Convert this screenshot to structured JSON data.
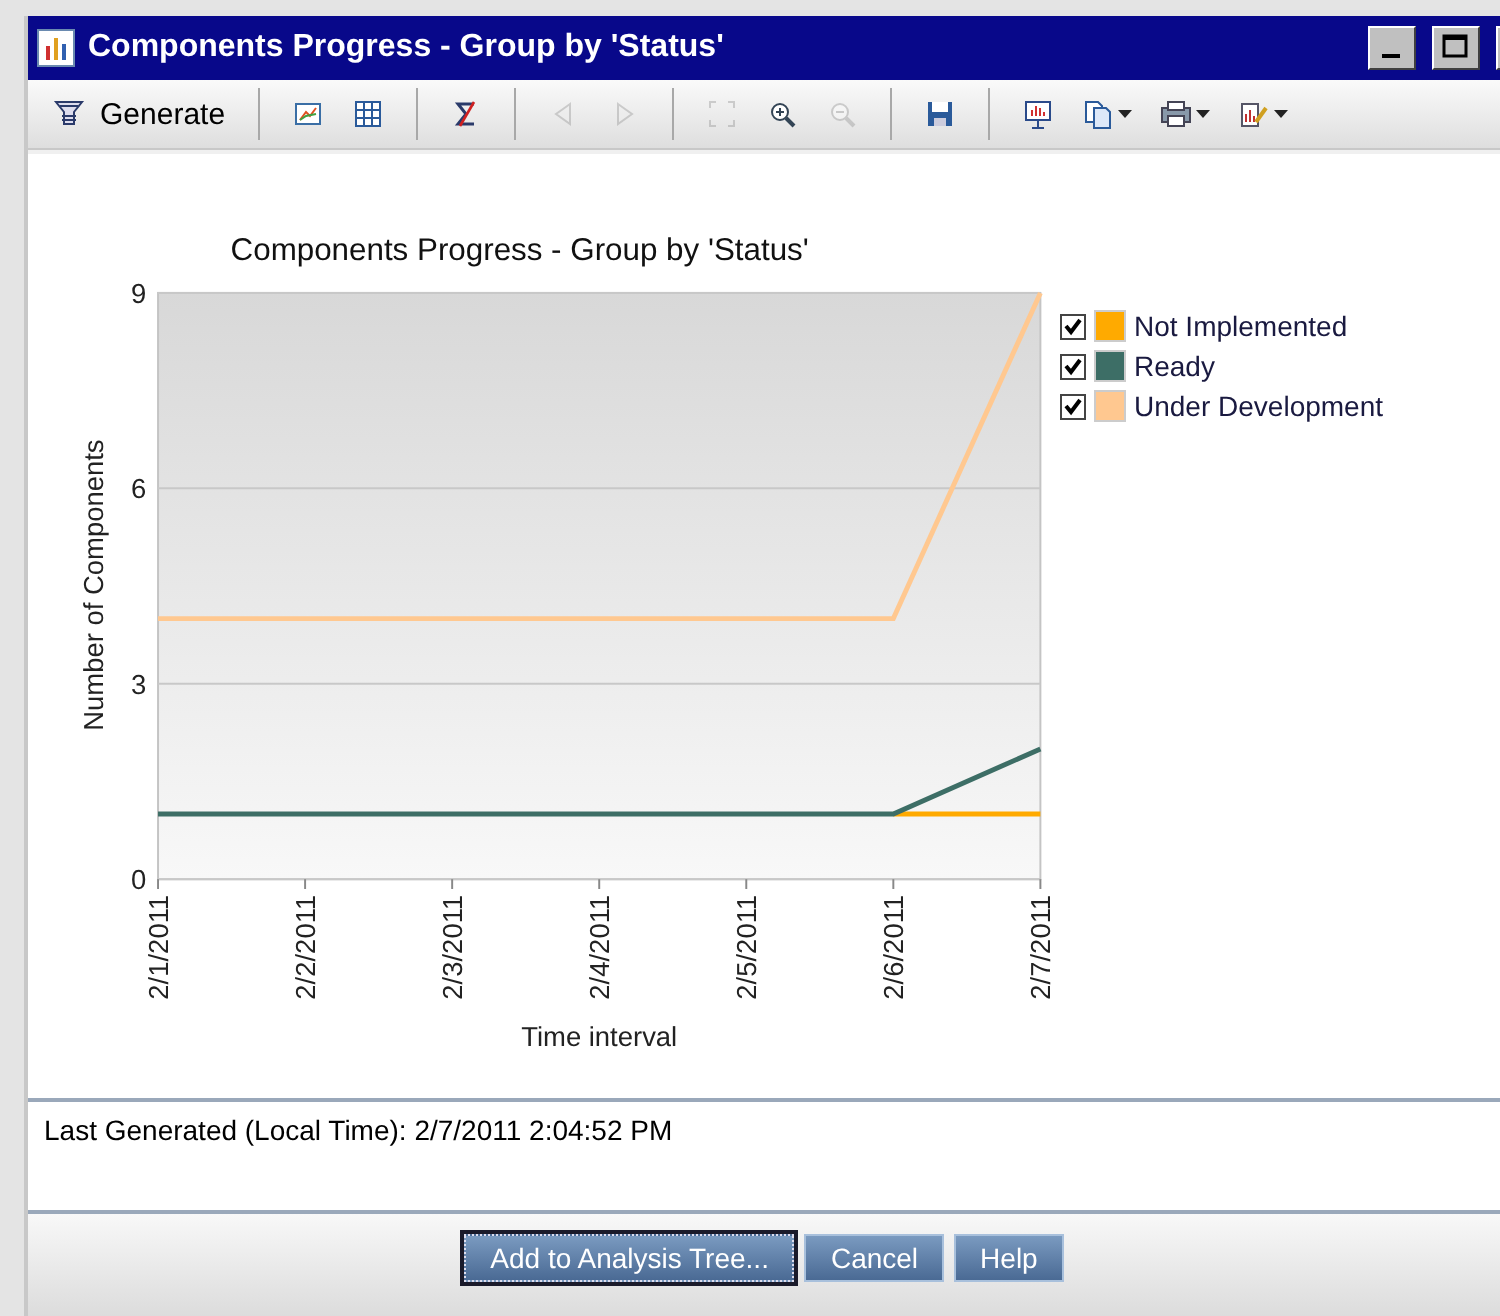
{
  "window": {
    "title": "Components Progress - Group by 'Status'"
  },
  "toolbar": {
    "generate": "Generate",
    "tools": [
      {
        "kind": "plain",
        "disabled": false
      },
      {
        "kind": "plain",
        "disabled": false
      },
      {
        "kind": "plain",
        "disabled": false
      },
      {
        "kind": "plain",
        "disabled": true
      },
      {
        "kind": "plain",
        "disabled": true
      },
      {
        "kind": "plain",
        "disabled": true
      },
      {
        "kind": "plain",
        "disabled": false
      },
      {
        "kind": "plain",
        "disabled": true
      },
      {
        "kind": "plain",
        "disabled": false
      },
      {
        "kind": "plain",
        "disabled": false
      },
      {
        "kind": "dropdown",
        "disabled": false
      },
      {
        "kind": "dropdown",
        "disabled": false
      },
      {
        "kind": "dropdown",
        "disabled": false
      }
    ]
  },
  "chart": {
    "legend": [
      {
        "checked": true
      },
      {
        "checked": true
      },
      {
        "checked": true
      }
    ],
    "chart_data": {
      "type": "line",
      "title": "Components Progress - Group by 'Status'",
      "xlabel": "Time interval",
      "ylabel": "Number of Components",
      "categories": [
        "2/1/2011",
        "2/2/2011",
        "2/3/2011",
        "2/4/2011",
        "2/5/2011",
        "2/6/2011",
        "2/7/2011"
      ],
      "ylim": [
        0,
        9
      ],
      "yticks": [
        0,
        3,
        6,
        9
      ],
      "series": [
        {
          "name": "Not Implemented",
          "color": "#ffaa00",
          "values": [
            null,
            null,
            null,
            null,
            null,
            1,
            1
          ]
        },
        {
          "name": "Ready",
          "color": "#3d6e66",
          "values": [
            1,
            1,
            1,
            1,
            1,
            1,
            2
          ]
        },
        {
          "name": "Under Development",
          "color": "#ffc890",
          "values": [
            4,
            4,
            4,
            4,
            4,
            4,
            9
          ]
        }
      ]
    }
  },
  "status": "Last Generated (Local Time): 2/7/2011 2:04:52 PM",
  "buttons": [
    {
      "label": "Add to Analysis Tree...",
      "focused": true
    },
    {
      "label": "Cancel",
      "focused": false
    },
    {
      "label": "Help",
      "focused": false
    }
  ]
}
